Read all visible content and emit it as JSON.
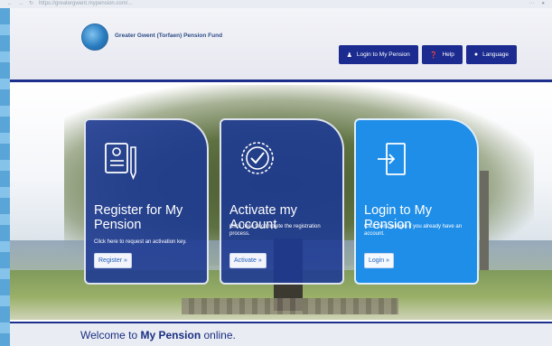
{
  "browser": {
    "url": "https://greatergwent.mypension.com/..."
  },
  "header": {
    "org_name": "Greater Gwent (Torfaen) Pension Fund",
    "nav": [
      {
        "label": "Login to My Pension",
        "icon": "user-icon"
      },
      {
        "label": "Help",
        "icon": "help-icon"
      },
      {
        "label": "Language",
        "icon": "globe-icon"
      }
    ]
  },
  "cards": [
    {
      "title": "Register for My Pension",
      "description": "Click here to request an activation key.",
      "cta": "Register »",
      "icon": "document-pen-icon"
    },
    {
      "title": "Activate my Account",
      "description": "Click here to complete the registration process.",
      "cta": "Activate »",
      "icon": "check-badge-icon"
    },
    {
      "title": "Login to My Pension",
      "description": "Click here to login if you already have an account.",
      "cta": "Login »",
      "icon": "login-door-icon"
    }
  ],
  "welcome": {
    "prefix": "Welcome to ",
    "brand": "My Pension",
    "suffix": " online."
  },
  "colors": {
    "brand_navy": "#1b2b8f",
    "card_dark": "#1c3994",
    "card_light": "#1f8ee8"
  }
}
